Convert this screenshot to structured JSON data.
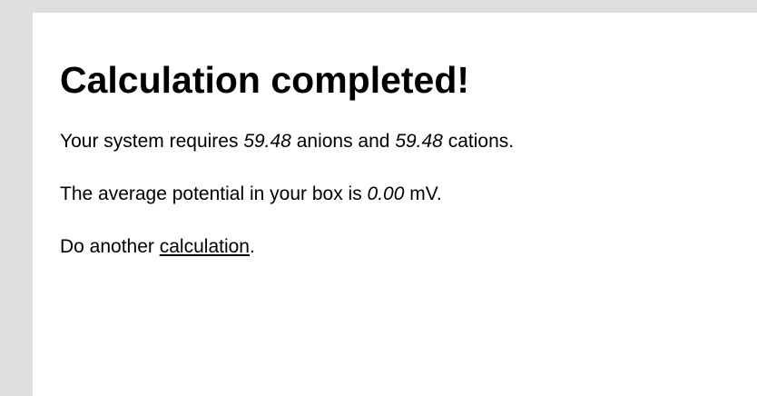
{
  "page": {
    "title": "Calculation completed!",
    "system_line": {
      "prefix": "Your system requires ",
      "anions_value": "59.48",
      "middle": " anions and ",
      "cations_value": "59.48",
      "suffix": " cations."
    },
    "potential_line": {
      "prefix": "The average potential in your box is ",
      "potential_value": "0.00",
      "suffix": " mV."
    },
    "again_line": {
      "prefix": "Do another ",
      "link_label": "calculation",
      "suffix": "."
    }
  },
  "colors": {
    "background": "#e0dfe0",
    "page": "#ffffff",
    "text": "#000000"
  }
}
